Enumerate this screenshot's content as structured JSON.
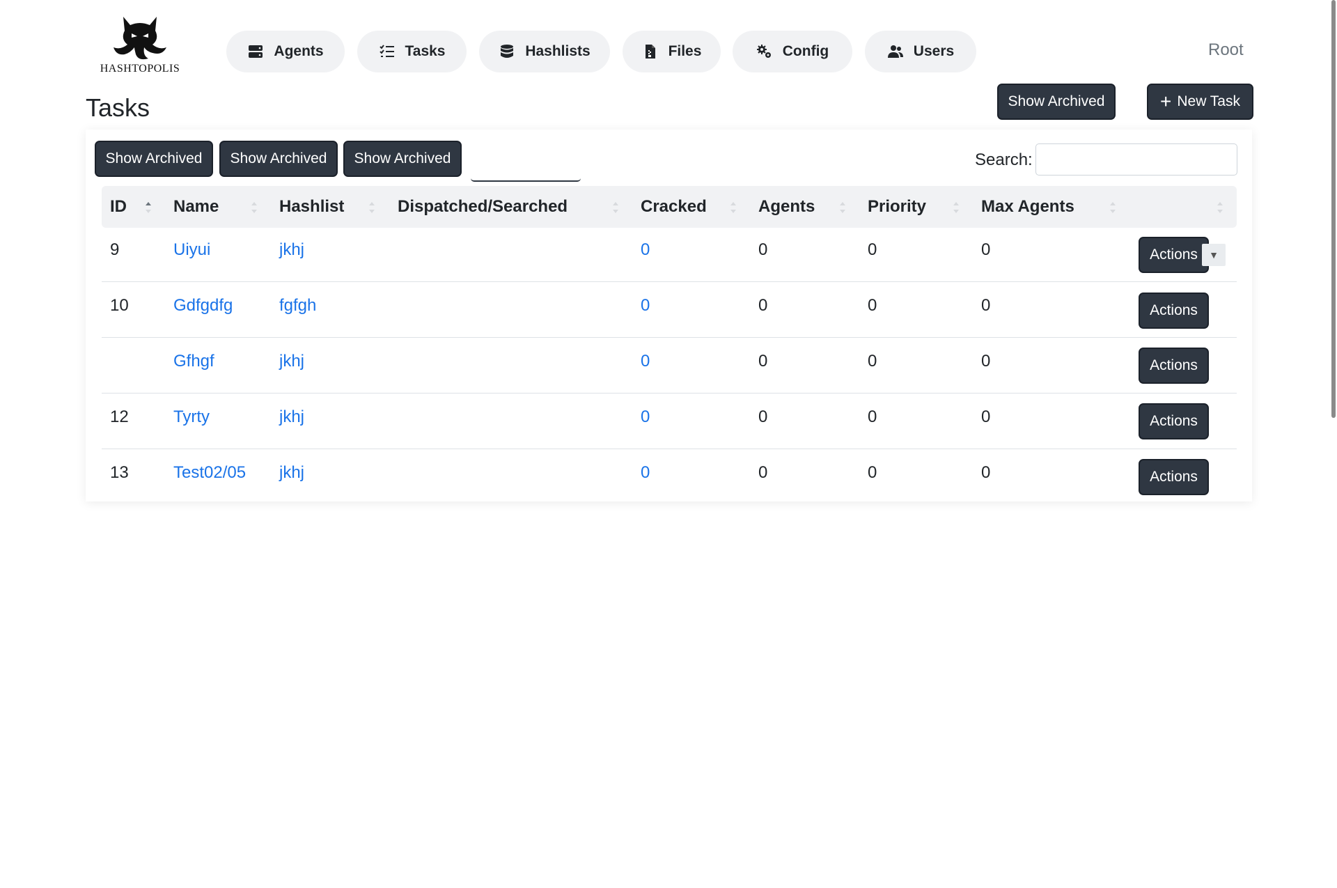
{
  "brand": {
    "logo_text": "HASHTOPOLIS",
    "logo_icon": "octopus-icon"
  },
  "nav": [
    {
      "label": "Agents",
      "icon": "server-icon"
    },
    {
      "label": "Tasks",
      "icon": "task-list-icon"
    },
    {
      "label": "Hashlists",
      "icon": "database-icon"
    },
    {
      "label": "Files",
      "icon": "file-icon"
    },
    {
      "label": "Config",
      "icon": "gears-icon"
    },
    {
      "label": "Users",
      "icon": "users-icon"
    }
  ],
  "user": {
    "name": "Root"
  },
  "page": {
    "title": "Tasks"
  },
  "toolbar": {
    "show_archived_label": "Show Archived",
    "new_task_label": "New Task"
  },
  "filters": [
    "Show Archived",
    "Show Archived",
    "Show Archived"
  ],
  "search": {
    "label": "Search:",
    "value": ""
  },
  "table": {
    "headers": [
      "ID",
      "Name",
      "Hashlist",
      "Dispatched/Searched",
      "Cracked",
      "Agents",
      "Priority",
      "Max Agents",
      ""
    ],
    "rows": [
      {
        "id": "9",
        "name": "Uiyui",
        "hashlist": "jkhj",
        "dispatched": "",
        "cracked": "0",
        "agents": "0",
        "priority": "0",
        "max_agents": "0",
        "action": "Actions"
      },
      {
        "id": "10",
        "name": "Gdfgdfg",
        "hashlist": "fgfgh",
        "dispatched": "",
        "cracked": "0",
        "agents": "0",
        "priority": "0",
        "max_agents": "0",
        "action": "Actions"
      },
      {
        "id": "",
        "name": "Gfhgf",
        "hashlist": "jkhj",
        "dispatched": "",
        "cracked": "0",
        "agents": "0",
        "priority": "0",
        "max_agents": "0",
        "action": "Actions"
      },
      {
        "id": "12",
        "name": "Tyrty",
        "hashlist": "jkhj",
        "dispatched": "",
        "cracked": "0",
        "agents": "0",
        "priority": "0",
        "max_agents": "0",
        "action": "Actions"
      },
      {
        "id": "13",
        "name": "Test02/05",
        "hashlist": "jkhj",
        "dispatched": "",
        "cracked": "0",
        "agents": "0",
        "priority": "0",
        "max_agents": "0",
        "action": "Actions"
      }
    ]
  },
  "colors": {
    "link": "#1a73e8",
    "button_dark": "#2f3742",
    "nav_bg": "#f1f2f4",
    "muted": "#6c757d"
  }
}
